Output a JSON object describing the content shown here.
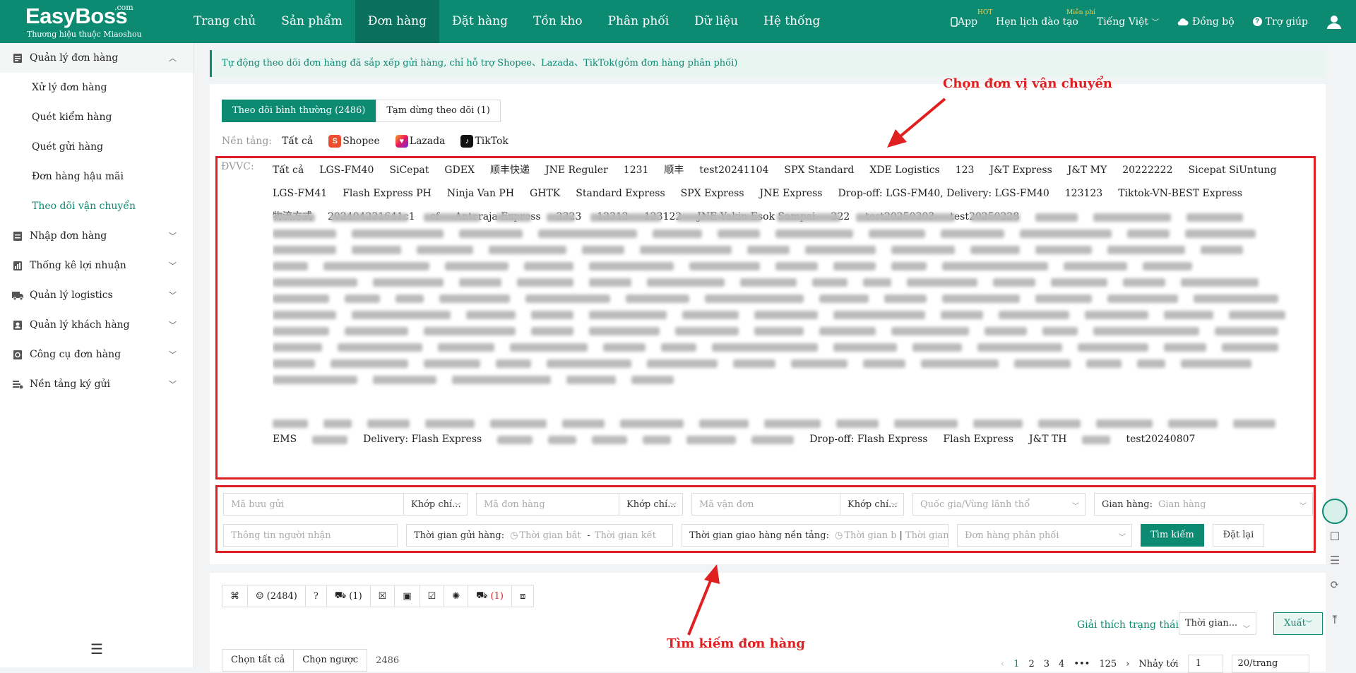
{
  "header": {
    "logo": "EasyBoss",
    "logo_com": ".com",
    "logo_sub": "Thương hiệu thuộc Miaoshou",
    "nav": [
      "Trang chủ",
      "Sản phẩm",
      "Đơn hàng",
      "Đặt hàng",
      "Tồn kho",
      "Phân phối",
      "Dữ liệu",
      "Hệ thống"
    ],
    "app": "App",
    "app_badge": "HOT",
    "schedule": "Hẹn lịch đào tạo",
    "schedule_badge": "Miễn phí",
    "language": "Tiếng Việt",
    "sync": "Đồng bộ",
    "help": "Trợ giúp"
  },
  "sidebar": {
    "groups": [
      {
        "label": "Quản lý đơn hàng",
        "items": [
          "Xử lý đơn hàng",
          "Quét kiểm hàng",
          "Quét gửi hàng",
          "Đơn hàng hậu mãi",
          "Theo dõi vận chuyển"
        ]
      },
      {
        "label": "Nhập đơn hàng"
      },
      {
        "label": "Thống kê lợi nhuận"
      },
      {
        "label": "Quản lý logistics"
      },
      {
        "label": "Quản lý khách hàng"
      },
      {
        "label": "Công cụ đơn hàng"
      },
      {
        "label": "Nền tảng ký gửi"
      }
    ]
  },
  "notice": "Tự động theo dõi đơn hàng đã sắp xếp gửi hàng, chỉ hỗ trợ Shopee、Lazada、TikTok(gồm đơn hàng phân phối)",
  "tabs": [
    "Theo dõi bình thường (2486)",
    "Tạm dừng theo dõi (1)"
  ],
  "platform": {
    "label": "Nền tảng:",
    "options": [
      "Tất cả",
      "Shopee",
      "Lazada",
      "TikTok"
    ]
  },
  "carrier_label": "ĐVVC:",
  "carriers": [
    "Tất cả",
    "LGS-FM40",
    "SiCepat",
    "GDEX",
    "顺丰快递",
    "JNE Reguler",
    "1231",
    "顺丰",
    "test20241104",
    "SPX Standard",
    "XDE Logistics",
    "123",
    "J&T Express",
    "J&T MY",
    "20222222",
    "Sicepat SiUntung",
    "LGS-FM41",
    "Flash Express PH",
    "Ninja Van PH",
    "GHTK",
    "Standard Express",
    "SPX Express",
    "JNE Express",
    "Drop-off: LGS-FM40, Delivery: LGS-FM40",
    "123123",
    "Tiktok-VN-BEST Express",
    "物流方式",
    "202404231641c1",
    "sf",
    "Anteraja Express",
    "2323",
    "12312",
    "123122",
    "JNE Yakin Esok Sampai",
    "222",
    "test20250303",
    "test20250228"
  ],
  "carriers_tail": [
    "EMS",
    "Delivery: Flash Express",
    "Drop-off: Flash Express",
    "Flash Express",
    "J&T TH",
    "test20240807"
  ],
  "search": {
    "tracking_ph": "Mã bưu gửi",
    "match": "Khớp chí...",
    "order_ph": "Mã đơn hàng",
    "waybill_ph": "Mã vận đơn",
    "country_ph": "Quốc gia/Vùng lãnh thổ",
    "shop_label": "Gian hàng:",
    "shop_ph": "Gian hàng",
    "receiver_ph": "Thông tin người nhận",
    "send_time_label": "Thời gian gửi hàng:",
    "start_ph": "Thời gian bắt đầ",
    "end_ph": "Thời gian kết th",
    "deliver_label": "Thời gian giao hàng nền tảng:",
    "start2_ph": "Thời gian b",
    "end2_ph": "Thời gian k",
    "dist_ph": "Đơn hàng phân phối",
    "search_btn": "Tìm kiếm",
    "reset_btn": "Đặt lại"
  },
  "status": {
    "all_count": "(2484)",
    "pending_count": "(1)",
    "error_count": "(1)"
  },
  "explain": "Giải thích trạng thái",
  "time_select": "Thời gian...",
  "export": "Xuất",
  "bottom": {
    "select_all": "Chọn tất cả",
    "invert": "Chọn ngược",
    "total": "2486"
  },
  "pager": {
    "pages": [
      "1",
      "2",
      "3",
      "4",
      "•••",
      "125"
    ],
    "jump": "Nhảy tới",
    "jump_val": "1",
    "size": "20/trang"
  },
  "annotations": {
    "top": "Chọn đơn vị vận chuyển",
    "bottom": "Tìm kiếm đơn hàng"
  },
  "colors": {
    "brand": "#0c8a72",
    "annotation": "#e02020"
  }
}
